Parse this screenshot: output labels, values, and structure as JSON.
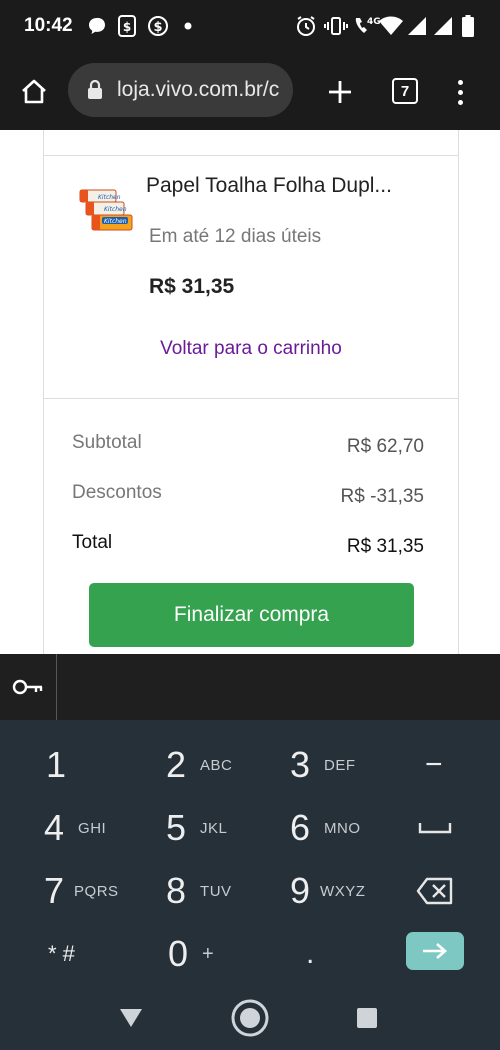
{
  "status_bar": {
    "time": "10:42",
    "network": "4G",
    "icons": [
      "chat-icon",
      "money-app-icon",
      "dollar-icon",
      "dot-icon",
      "alarm-icon",
      "vibrate-icon",
      "wifi-call-icon",
      "wifi-icon",
      "signal-icon",
      "signal-icon",
      "battery-icon"
    ]
  },
  "browser": {
    "url": "loja.vivo.com.br/c",
    "tab_count": "7"
  },
  "product": {
    "name": "Papel Toalha Folha Dupl...",
    "delivery": "Em até 12 dias úteis",
    "price": "R$ 31,35"
  },
  "back_link": "Voltar para o carrinho",
  "summary": {
    "subtotal_label": "Subtotal",
    "subtotal_value": "R$ 62,70",
    "discounts_label": "Descontos",
    "discounts_value": "R$ -31,35",
    "total_label": "Total",
    "total_value": "R$ 31,35"
  },
  "checkout_button": "Finalizar compra",
  "keyboard": {
    "keys": [
      {
        "digit": "1",
        "letters": ""
      },
      {
        "digit": "2",
        "letters": "ABC"
      },
      {
        "digit": "3",
        "letters": "DEF"
      },
      {
        "digit": "4",
        "letters": "GHI"
      },
      {
        "digit": "5",
        "letters": "JKL"
      },
      {
        "digit": "6",
        "letters": "MNO"
      },
      {
        "digit": "7",
        "letters": "PQRS"
      },
      {
        "digit": "8",
        "letters": "TUV"
      },
      {
        "digit": "9",
        "letters": "WXYZ"
      },
      {
        "digit": "0",
        "letters": "+"
      }
    ],
    "minus": "−",
    "symbols": "* #",
    "period": "."
  },
  "colors": {
    "checkout_green": "#34a24e",
    "link_purple": "#6a1b9a",
    "keyboard_bg": "#253039",
    "enter_key": "#7ec8c3"
  }
}
